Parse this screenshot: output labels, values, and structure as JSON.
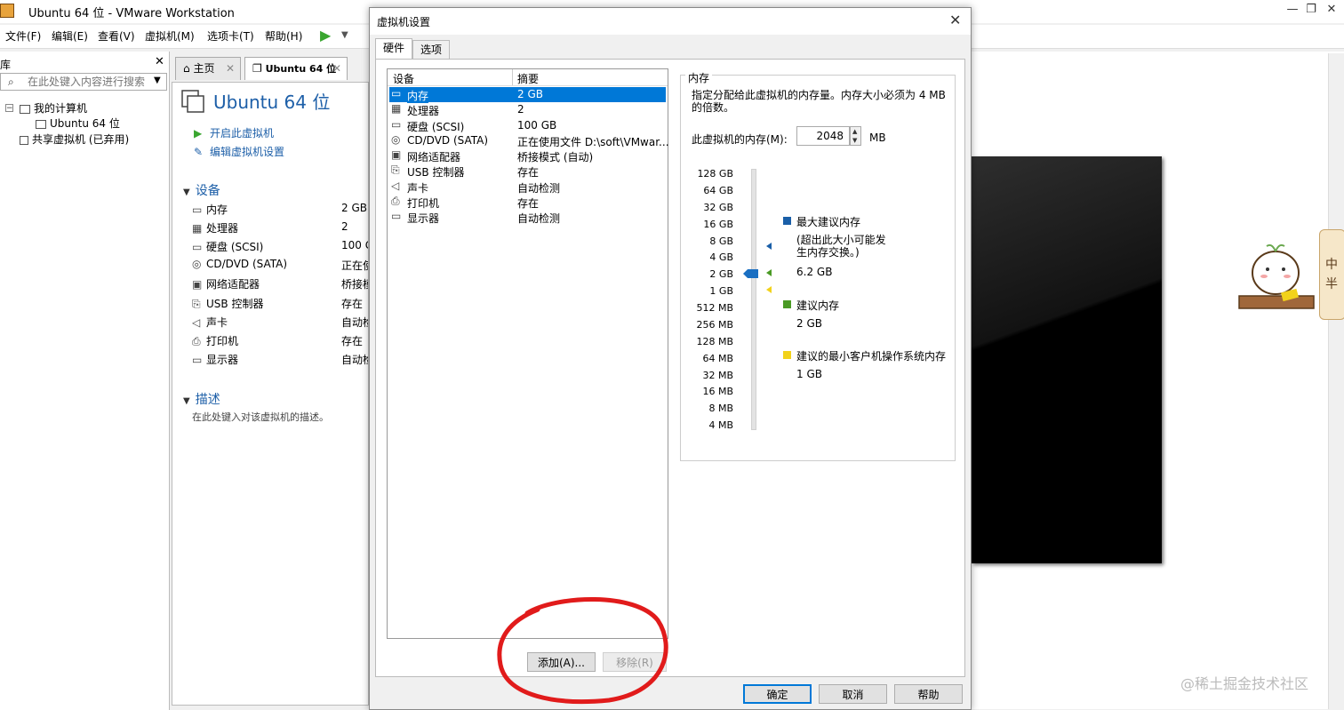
{
  "window": {
    "title": "Ubuntu 64 位 - VMware Workstation",
    "minimize": "—",
    "maximize": "❐",
    "close": "✕"
  },
  "menu": [
    "文件(F)",
    "编辑(E)",
    "查看(V)",
    "虚拟机(M)",
    "选项卡(T)",
    "帮助(H)"
  ],
  "library": {
    "title": "库",
    "close": "✕",
    "search_placeholder": "在此处键入内容进行搜索",
    "tree": {
      "my_computer": "我的计算机",
      "vm": "Ubuntu 64 位",
      "shared": "共享虚拟机 (已弃用)"
    }
  },
  "tabs": [
    {
      "label": "主页",
      "icon": "home-icon"
    },
    {
      "label": "Ubuntu 64 位",
      "icon": "vm-icon"
    }
  ],
  "summary": {
    "vm_name": "Ubuntu 64 位",
    "actions": [
      "开启此虚拟机",
      "编辑虚拟机设置"
    ],
    "devices_title": "设备",
    "devices": [
      {
        "name": "内存",
        "value": "2 GB"
      },
      {
        "name": "处理器",
        "value": "2"
      },
      {
        "name": "硬盘 (SCSI)",
        "value": "100 G"
      },
      {
        "name": "CD/DVD (SATA)",
        "value": "正在使"
      },
      {
        "name": "网络适配器",
        "value": "桥接模"
      },
      {
        "name": "USB 控制器",
        "value": "存在"
      },
      {
        "name": "声卡",
        "value": "自动检"
      },
      {
        "name": "打印机",
        "value": "存在"
      },
      {
        "name": "显示器",
        "value": "自动检"
      }
    ],
    "desc_title": "描述",
    "desc_placeholder": "在此处键入对该虚拟机的描述。"
  },
  "dialog": {
    "title": "虚拟机设置",
    "close": "✕",
    "tabs": [
      "硬件",
      "选项"
    ],
    "list_headers": [
      "设备",
      "摘要"
    ],
    "devices": [
      {
        "name": "内存",
        "summary": "2 GB",
        "icon": "memory-icon"
      },
      {
        "name": "处理器",
        "summary": "2",
        "icon": "cpu-icon"
      },
      {
        "name": "硬盘 (SCSI)",
        "summary": "100 GB",
        "icon": "disk-icon"
      },
      {
        "name": "CD/DVD (SATA)",
        "summary": "正在使用文件 D:\\soft\\VMwar...",
        "icon": "cd-icon"
      },
      {
        "name": "网络适配器",
        "summary": "桥接模式 (自动)",
        "icon": "network-icon"
      },
      {
        "name": "USB 控制器",
        "summary": "存在",
        "icon": "usb-icon"
      },
      {
        "name": "声卡",
        "summary": "自动检测",
        "icon": "speaker-icon"
      },
      {
        "name": "打印机",
        "summary": "存在",
        "icon": "printer-icon"
      },
      {
        "name": "显示器",
        "summary": "自动检测",
        "icon": "monitor-icon"
      }
    ],
    "add_button": "添加(A)...",
    "remove_button": "移除(R)",
    "memory": {
      "group_title": "内存",
      "description": "指定分配给此虚拟机的内存量。内存大小必须为 4 MB 的倍数。",
      "field_label": "此虚拟机的内存(M):",
      "value": "2048",
      "unit": "MB",
      "scale": [
        "128 GB",
        "64 GB",
        "32 GB",
        "16 GB",
        "8 GB",
        "4 GB",
        "2 GB",
        "1 GB",
        "512 MB",
        "256 MB",
        "128 MB",
        "64 MB",
        "32 MB",
        "16 MB",
        "8 MB",
        "4 MB"
      ],
      "legend": {
        "max_label": "最大建议内存",
        "max_note": "(超出此大小可能发生内存交换。)",
        "max_value": "6.2 GB",
        "rec_label": "建议内存",
        "rec_value": "2 GB",
        "min_label": "建议的最小客户机操作系统内存",
        "min_value": "1 GB"
      },
      "colors": {
        "max": "#1a5fa8",
        "rec": "#4a9a24",
        "min": "#f2d21b"
      }
    },
    "ok_button": "确定",
    "cancel_button": "取消",
    "help_button": "帮助"
  },
  "sticker_text": [
    "中",
    "半"
  ],
  "watermark": "@稀土掘金技术社区"
}
